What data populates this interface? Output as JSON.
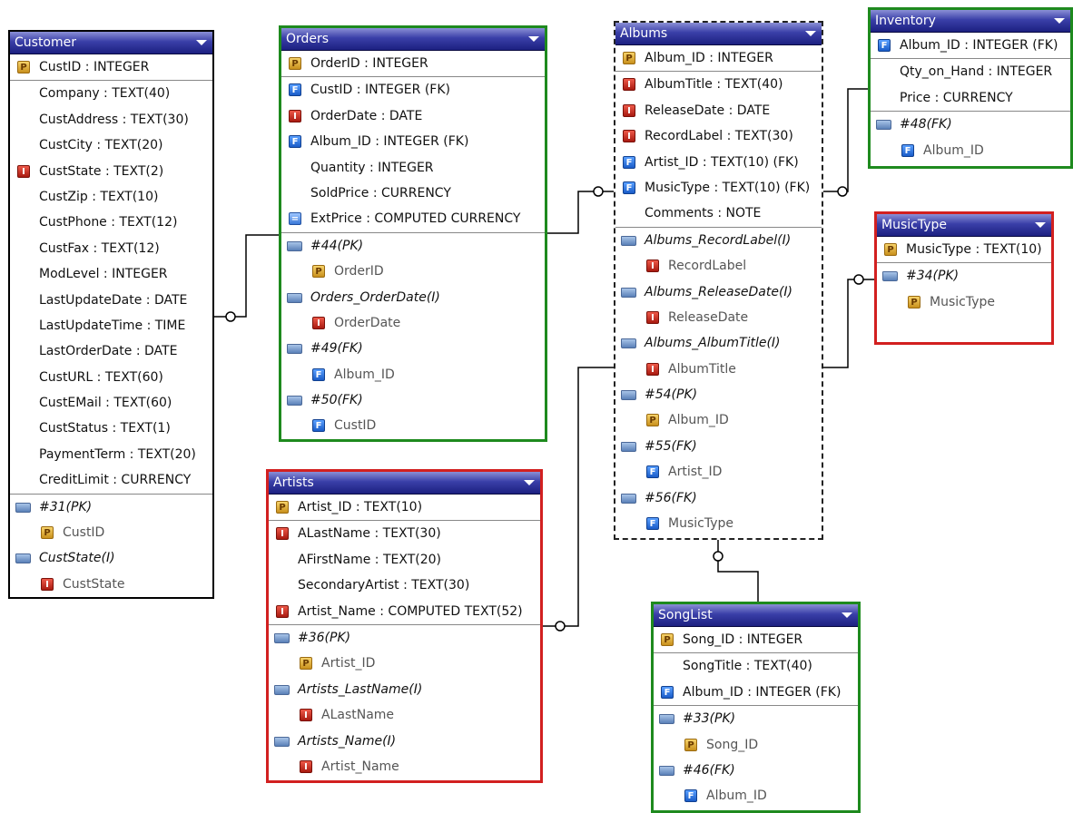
{
  "tables": {
    "customer": {
      "title": "Customer",
      "rows": [
        {
          "icon": "primary-key-icon",
          "text": "CustID : INTEGER"
        },
        {
          "icon": "none",
          "text": "Company : TEXT(40)"
        },
        {
          "icon": "none",
          "text": "CustAddress : TEXT(30)"
        },
        {
          "icon": "none",
          "text": "CustCity : TEXT(20)"
        },
        {
          "icon": "indexed-field-icon",
          "text": "CustState : TEXT(2)"
        },
        {
          "icon": "none",
          "text": "CustZip : TEXT(10)"
        },
        {
          "icon": "none",
          "text": "CustPhone : TEXT(12)"
        },
        {
          "icon": "none",
          "text": "CustFax : TEXT(12)"
        },
        {
          "icon": "none",
          "text": "ModLevel : INTEGER"
        },
        {
          "icon": "none",
          "text": "LastUpdateDate : DATE"
        },
        {
          "icon": "none",
          "text": "LastUpdateTime : TIME"
        },
        {
          "icon": "none",
          "text": "LastOrderDate : DATE"
        },
        {
          "icon": "none",
          "text": "CustURL : TEXT(60)"
        },
        {
          "icon": "none",
          "text": "CustEMail : TEXT(60)"
        },
        {
          "icon": "none",
          "text": "CustStatus : TEXT(1)"
        },
        {
          "icon": "none",
          "text": "PaymentTerm : TEXT(20)"
        },
        {
          "icon": "none",
          "text": "CreditLimit : CURRENCY"
        }
      ],
      "indexes": [
        {
          "name": "#31(PK)",
          "fields": [
            {
              "icon": "primary-key-icon",
              "text": "CustID"
            }
          ]
        },
        {
          "name": "CustState(I)",
          "fields": [
            {
              "icon": "indexed-field-icon",
              "text": "CustState"
            }
          ]
        }
      ]
    },
    "orders": {
      "title": "Orders",
      "rows": [
        {
          "icon": "primary-key-icon",
          "text": "OrderID : INTEGER"
        },
        {
          "icon": "foreign-key-icon",
          "text": "CustID : INTEGER (FK)"
        },
        {
          "icon": "indexed-field-icon",
          "text": "OrderDate : DATE"
        },
        {
          "icon": "foreign-key-icon",
          "text": "Album_ID : INTEGER (FK)"
        },
        {
          "icon": "none",
          "text": "Quantity : INTEGER"
        },
        {
          "icon": "none",
          "text": "SoldPrice : CURRENCY"
        },
        {
          "icon": "calculator-icon",
          "text": "ExtPrice : COMPUTED CURRENCY"
        }
      ],
      "indexes": [
        {
          "name": "#44(PK)",
          "fields": [
            {
              "icon": "primary-key-icon",
              "text": "OrderID"
            }
          ]
        },
        {
          "name": "Orders_OrderDate(I)",
          "fields": [
            {
              "icon": "indexed-field-icon",
              "text": "OrderDate"
            }
          ]
        },
        {
          "name": "#49(FK)",
          "fields": [
            {
              "icon": "foreign-key-icon",
              "text": "Album_ID"
            }
          ]
        },
        {
          "name": "#50(FK)",
          "fields": [
            {
              "icon": "foreign-key-icon",
              "text": "CustID"
            }
          ]
        }
      ]
    },
    "albums": {
      "title": "Albums",
      "rows": [
        {
          "icon": "primary-key-icon",
          "text": "Album_ID : INTEGER"
        },
        {
          "icon": "indexed-field-icon",
          "text": "AlbumTitle : TEXT(40)"
        },
        {
          "icon": "indexed-field-icon",
          "text": "ReleaseDate : DATE"
        },
        {
          "icon": "indexed-field-icon",
          "text": "RecordLabel : TEXT(30)"
        },
        {
          "icon": "foreign-key-icon",
          "text": "Artist_ID : TEXT(10) (FK)"
        },
        {
          "icon": "foreign-key-icon",
          "text": "MusicType : TEXT(10) (FK)"
        },
        {
          "icon": "none",
          "text": "Comments : NOTE"
        }
      ],
      "indexes": [
        {
          "name": "Albums_RecordLabel(I)",
          "fields": [
            {
              "icon": "indexed-field-icon",
              "text": "RecordLabel"
            }
          ]
        },
        {
          "name": "Albums_ReleaseDate(I)",
          "fields": [
            {
              "icon": "indexed-field-icon",
              "text": "ReleaseDate"
            }
          ]
        },
        {
          "name": "Albums_AlbumTitle(I)",
          "fields": [
            {
              "icon": "indexed-field-icon",
              "text": "AlbumTitle"
            }
          ]
        },
        {
          "name": "#54(PK)",
          "fields": [
            {
              "icon": "primary-key-icon",
              "text": "Album_ID"
            }
          ]
        },
        {
          "name": "#55(FK)",
          "fields": [
            {
              "icon": "foreign-key-icon",
              "text": "Artist_ID"
            }
          ]
        },
        {
          "name": "#56(FK)",
          "fields": [
            {
              "icon": "foreign-key-icon",
              "text": "MusicType"
            }
          ]
        }
      ]
    },
    "inventory": {
      "title": "Inventory",
      "rows": [
        {
          "icon": "foreign-key-icon",
          "text": "Album_ID : INTEGER (FK)"
        },
        {
          "icon": "none",
          "text": "Qty_on_Hand : INTEGER"
        },
        {
          "icon": "none",
          "text": "Price : CURRENCY"
        }
      ],
      "indexes": [
        {
          "name": "#48(FK)",
          "fields": [
            {
              "icon": "foreign-key-icon",
              "text": "Album_ID"
            }
          ]
        }
      ]
    },
    "musictype": {
      "title": "MusicType",
      "rows": [
        {
          "icon": "primary-key-icon",
          "text": "MusicType : TEXT(10)"
        }
      ],
      "indexes": [
        {
          "name": "#34(PK)",
          "fields": [
            {
              "icon": "primary-key-icon",
              "text": "MusicType"
            }
          ]
        }
      ]
    },
    "artists": {
      "title": "Artists",
      "rows": [
        {
          "icon": "primary-key-icon",
          "text": "Artist_ID : TEXT(10)"
        },
        {
          "icon": "indexed-field-icon",
          "text": "ALastName : TEXT(30)"
        },
        {
          "icon": "none",
          "text": "AFirstName : TEXT(20)"
        },
        {
          "icon": "none",
          "text": "SecondaryArtist : TEXT(30)"
        },
        {
          "icon": "indexed-field-icon",
          "text": "Artist_Name : COMPUTED TEXT(52)"
        }
      ],
      "indexes": [
        {
          "name": "#36(PK)",
          "fields": [
            {
              "icon": "primary-key-icon",
              "text": "Artist_ID"
            }
          ]
        },
        {
          "name": "Artists_LastName(I)",
          "fields": [
            {
              "icon": "indexed-field-icon",
              "text": "ALastName"
            }
          ]
        },
        {
          "name": "Artists_Name(I)",
          "fields": [
            {
              "icon": "indexed-field-icon",
              "text": "Artist_Name"
            }
          ]
        }
      ]
    },
    "songlist": {
      "title": "SongList",
      "rows": [
        {
          "icon": "primary-key-icon",
          "text": "Song_ID : INTEGER"
        },
        {
          "icon": "none",
          "text": "SongTitle : TEXT(40)"
        },
        {
          "icon": "foreign-key-icon",
          "text": "Album_ID : INTEGER (FK)"
        }
      ],
      "indexes": [
        {
          "name": "#33(PK)",
          "fields": [
            {
              "icon": "primary-key-icon",
              "text": "Song_ID"
            }
          ]
        },
        {
          "name": "#46(FK)",
          "fields": [
            {
              "icon": "foreign-key-icon",
              "text": "Album_ID"
            }
          ]
        }
      ]
    }
  },
  "colors": {
    "header_top": "#8a8fd6",
    "header_bottom": "#1c2080",
    "selected_border": "#1e8a1e",
    "warning_border": "#d22020",
    "connector": "#000000"
  }
}
